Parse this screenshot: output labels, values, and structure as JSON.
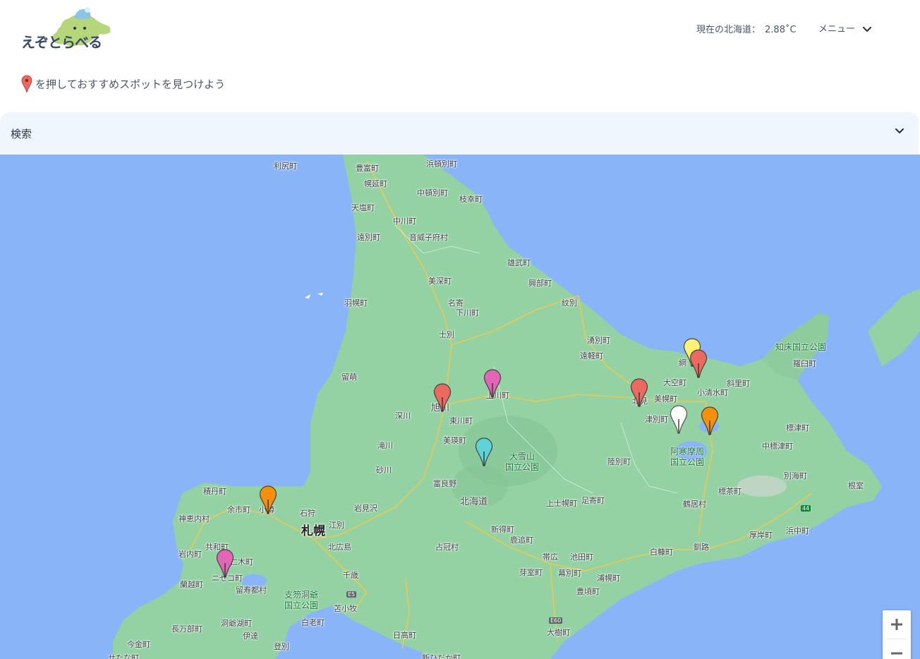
{
  "header": {
    "logo_text": "えぞとらべる",
    "temperature_label": "現在の北海道：",
    "temperature_value": "2.88˚C",
    "menu_label": "メニュー"
  },
  "hint": {
    "text": "を押しておすすめスポットを見つけよう"
  },
  "search": {
    "label": "検索"
  },
  "map": {
    "places": [
      {
        "name": "利尻町"
      },
      {
        "name": "浜頓別町"
      },
      {
        "name": "豊富町"
      },
      {
        "name": "幌延町"
      },
      {
        "name": "中頓別町"
      },
      {
        "name": "枝幸町"
      },
      {
        "name": "天塩町"
      },
      {
        "name": "中川町"
      },
      {
        "name": "遠別町"
      },
      {
        "name": "音威子府村"
      },
      {
        "name": "雄武町"
      },
      {
        "name": "美深町"
      },
      {
        "name": "興部町"
      },
      {
        "name": "名寄"
      },
      {
        "name": "羽幌町"
      },
      {
        "name": "下川町"
      },
      {
        "name": "紋別"
      },
      {
        "name": "士別"
      },
      {
        "name": "湧別町"
      },
      {
        "name": "遠軽町"
      },
      {
        "name": "留萌"
      },
      {
        "name": "上川町"
      },
      {
        "name": "旭川"
      },
      {
        "name": "深川"
      },
      {
        "name": "東川町"
      },
      {
        "name": "北見"
      },
      {
        "name": "大空町"
      },
      {
        "name": "美幌町"
      },
      {
        "name": "小清水町"
      },
      {
        "name": "斜里町"
      },
      {
        "name": "羅臼町"
      },
      {
        "name": "網"
      },
      {
        "name": "津別町"
      },
      {
        "name": "滝川"
      },
      {
        "name": "美瑛町"
      },
      {
        "name": "標津町"
      },
      {
        "name": "中標津町"
      },
      {
        "name": "砂川"
      },
      {
        "name": "陸別町"
      },
      {
        "name": "別海町"
      },
      {
        "name": "根室"
      },
      {
        "name": "積丹町"
      },
      {
        "name": "富良野"
      },
      {
        "name": "北海道"
      },
      {
        "name": "足寄町"
      },
      {
        "name": "標茶町"
      },
      {
        "name": "余市町"
      },
      {
        "name": "小樽"
      },
      {
        "name": "石狩"
      },
      {
        "name": "岩見沢"
      },
      {
        "name": "上士幌町"
      },
      {
        "name": "鶴居村"
      },
      {
        "name": "神恵内村"
      },
      {
        "name": "札幌"
      },
      {
        "name": "江別"
      },
      {
        "name": "新得町"
      },
      {
        "name": "鹿追町"
      },
      {
        "name": "厚岸町"
      },
      {
        "name": "浜中町"
      },
      {
        "name": "共和町"
      },
      {
        "name": "北広島"
      },
      {
        "name": "占冠村"
      },
      {
        "name": "岩内町"
      },
      {
        "name": "仁木町"
      },
      {
        "name": "帯広"
      },
      {
        "name": "池田町"
      },
      {
        "name": "白糠町"
      },
      {
        "name": "釧路"
      },
      {
        "name": "蘭越町"
      },
      {
        "name": "ニセコ町"
      },
      {
        "name": "千歳"
      },
      {
        "name": "芽室町"
      },
      {
        "name": "幕別町"
      },
      {
        "name": "浦幌町"
      },
      {
        "name": "留寿都村"
      },
      {
        "name": "豊頃町"
      },
      {
        "name": "苫小牧"
      },
      {
        "name": "長万部町"
      },
      {
        "name": "洞爺湖町"
      },
      {
        "name": "白老町"
      },
      {
        "name": "伊達"
      },
      {
        "name": "日高町"
      },
      {
        "name": "大樹町"
      },
      {
        "name": "今金町"
      },
      {
        "name": "登別"
      },
      {
        "name": "せたな町"
      },
      {
        "name": "新ひだか町"
      }
    ],
    "parks": [
      {
        "name": "知床国立公園"
      },
      {
        "name": "大雪山\n国立公園"
      },
      {
        "name": "阿寒摩周\n国立公園"
      },
      {
        "name": "支笏洞爺\n国立公園"
      }
    ],
    "roads": [
      "44",
      "E5",
      "E60"
    ],
    "markers": [
      {
        "name": "marker-asahikawa",
        "color": "#ea6a5f"
      },
      {
        "name": "marker-kamikawa",
        "color": "#e365b5"
      },
      {
        "name": "marker-daisetsu",
        "color": "#5ed4d8"
      },
      {
        "name": "marker-kitami",
        "color": "#ea6a5f"
      },
      {
        "name": "marker-abashiri-yellow",
        "color": "#fff176"
      },
      {
        "name": "marker-abashiri-red",
        "color": "#ea6a5f"
      },
      {
        "name": "marker-tsubetsu",
        "color": "#ffffff"
      },
      {
        "name": "marker-akan",
        "color": "#f4900c"
      },
      {
        "name": "marker-otaru",
        "color": "#f4900c"
      },
      {
        "name": "marker-niseko",
        "color": "#e365b5"
      }
    ],
    "zoom_in": "+",
    "zoom_out": "−"
  },
  "colors": {
    "sea": "#8ab4f8",
    "land": "#94d2a4",
    "search_bg": "#f0f6fd",
    "text": "#4a5568"
  }
}
